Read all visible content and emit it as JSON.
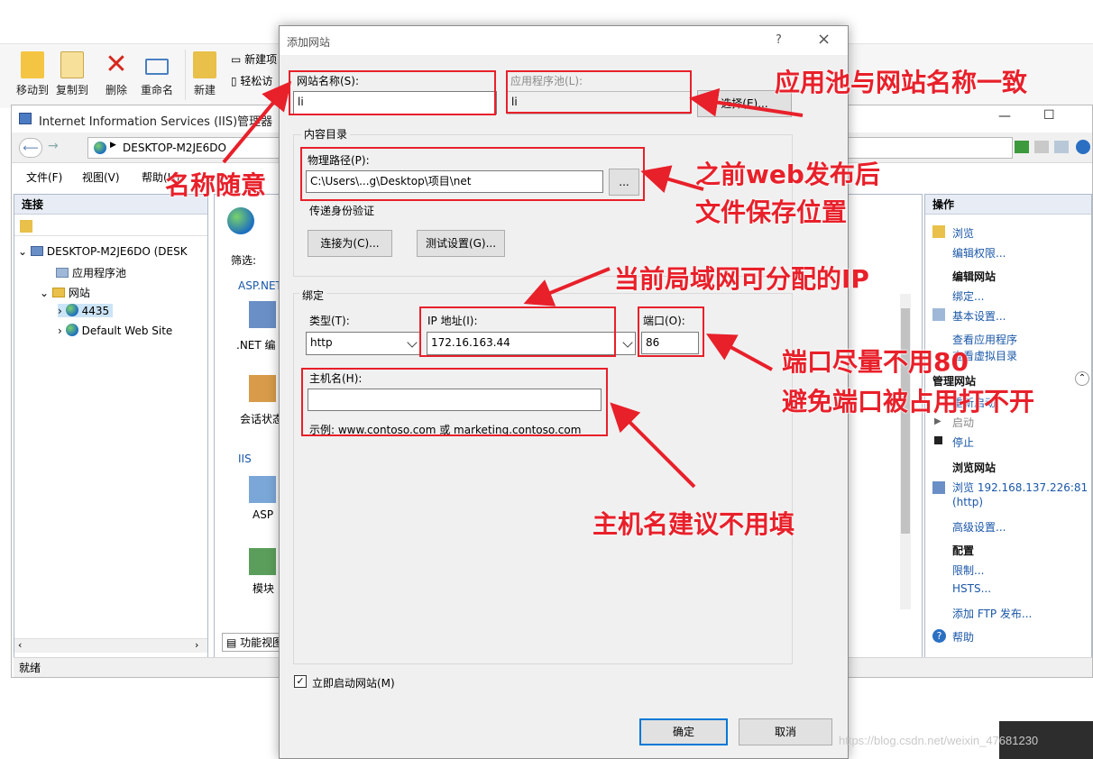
{
  "explorer_ribbon": {
    "buttons": [
      "移动到",
      "复制到",
      "删除",
      "重命名",
      "新建"
    ],
    "small_buttons": [
      "新建项",
      "轻松访"
    ]
  },
  "iis_window": {
    "title": "Internet Information Services (IIS)管理器",
    "address": "DESKTOP-M2JE6DO",
    "menu": [
      "文件(F)",
      "视图(V)",
      "帮助(H)"
    ],
    "connections": {
      "header": "连接",
      "tree": [
        "DESKTOP-M2JE6DO (DESK",
        "应用程序池",
        "网站",
        "4435",
        "Default Web Site"
      ]
    },
    "center": {
      "filter_label": "筛选:",
      "aspnet_group": "ASP.NET",
      "iis_group": "IIS",
      "items": [
        ".NET 编",
        "会话状态",
        "ASP",
        "模块"
      ],
      "view_tab": "功能视图"
    },
    "actions": {
      "header": "操作",
      "items": [
        "浏览",
        "编辑权限...",
        "编辑网站",
        "绑定...",
        "基本设置...",
        "查看应用程序",
        "查看虚拟目录",
        "管理网站",
        "重新启动",
        "启动",
        "停止",
        "浏览网站",
        "浏览 192.168.137.226:81",
        "(http)",
        "高级设置...",
        "配置",
        "限制...",
        "HSTS...",
        "添加 FTP 发布...",
        "帮助"
      ]
    },
    "status": "就绪"
  },
  "dialog": {
    "title": "添加网站",
    "help": "?",
    "close": "×",
    "site_name_label": "网站名称(S):",
    "site_name_value": "li",
    "app_pool_label": "应用程序池(L):",
    "app_pool_value": "li",
    "select_button": "选择(E)...",
    "content_dir_label": "内容目录",
    "physical_path_label": "物理路径(P):",
    "physical_path_value": "C:\\Users\\...g\\Desktop\\项目\\net",
    "browse_button": "...",
    "pass_auth_label": "传递身份验证",
    "connect_as_button": "连接为(C)...",
    "test_settings_button": "测试设置(G)...",
    "binding_label": "绑定",
    "type_label": "类型(T):",
    "type_value": "http",
    "ip_label": "IP 地址(I):",
    "ip_value": "172.16.163.44",
    "port_label": "端口(O):",
    "port_value": "86",
    "hostname_label": "主机名(H):",
    "hostname_value": "",
    "example_text": "示例: www.contoso.com 或 marketing.contoso.com",
    "start_now_label": "立即启动网站(M)",
    "ok_button": "确定",
    "cancel_button": "取消"
  },
  "annotations": {
    "app_pool_note": "应用池与网站名称一致",
    "name_note": "名称随意",
    "path_note_1": "之前web发布后",
    "path_note_2": "文件保存位置",
    "ip_note": "当前局域网可分配的IP",
    "port_note_1": "端口尽量不用80",
    "port_note_2": "避免端口被占用打不开",
    "hostname_note": "主机名建议不用填"
  },
  "watermark": "https://blog.csdn.net/weixin_47681230",
  "colors": {
    "annotation_red": "#e8202a",
    "link_blue": "#1a57a8",
    "focus_blue": "#0078d7"
  }
}
